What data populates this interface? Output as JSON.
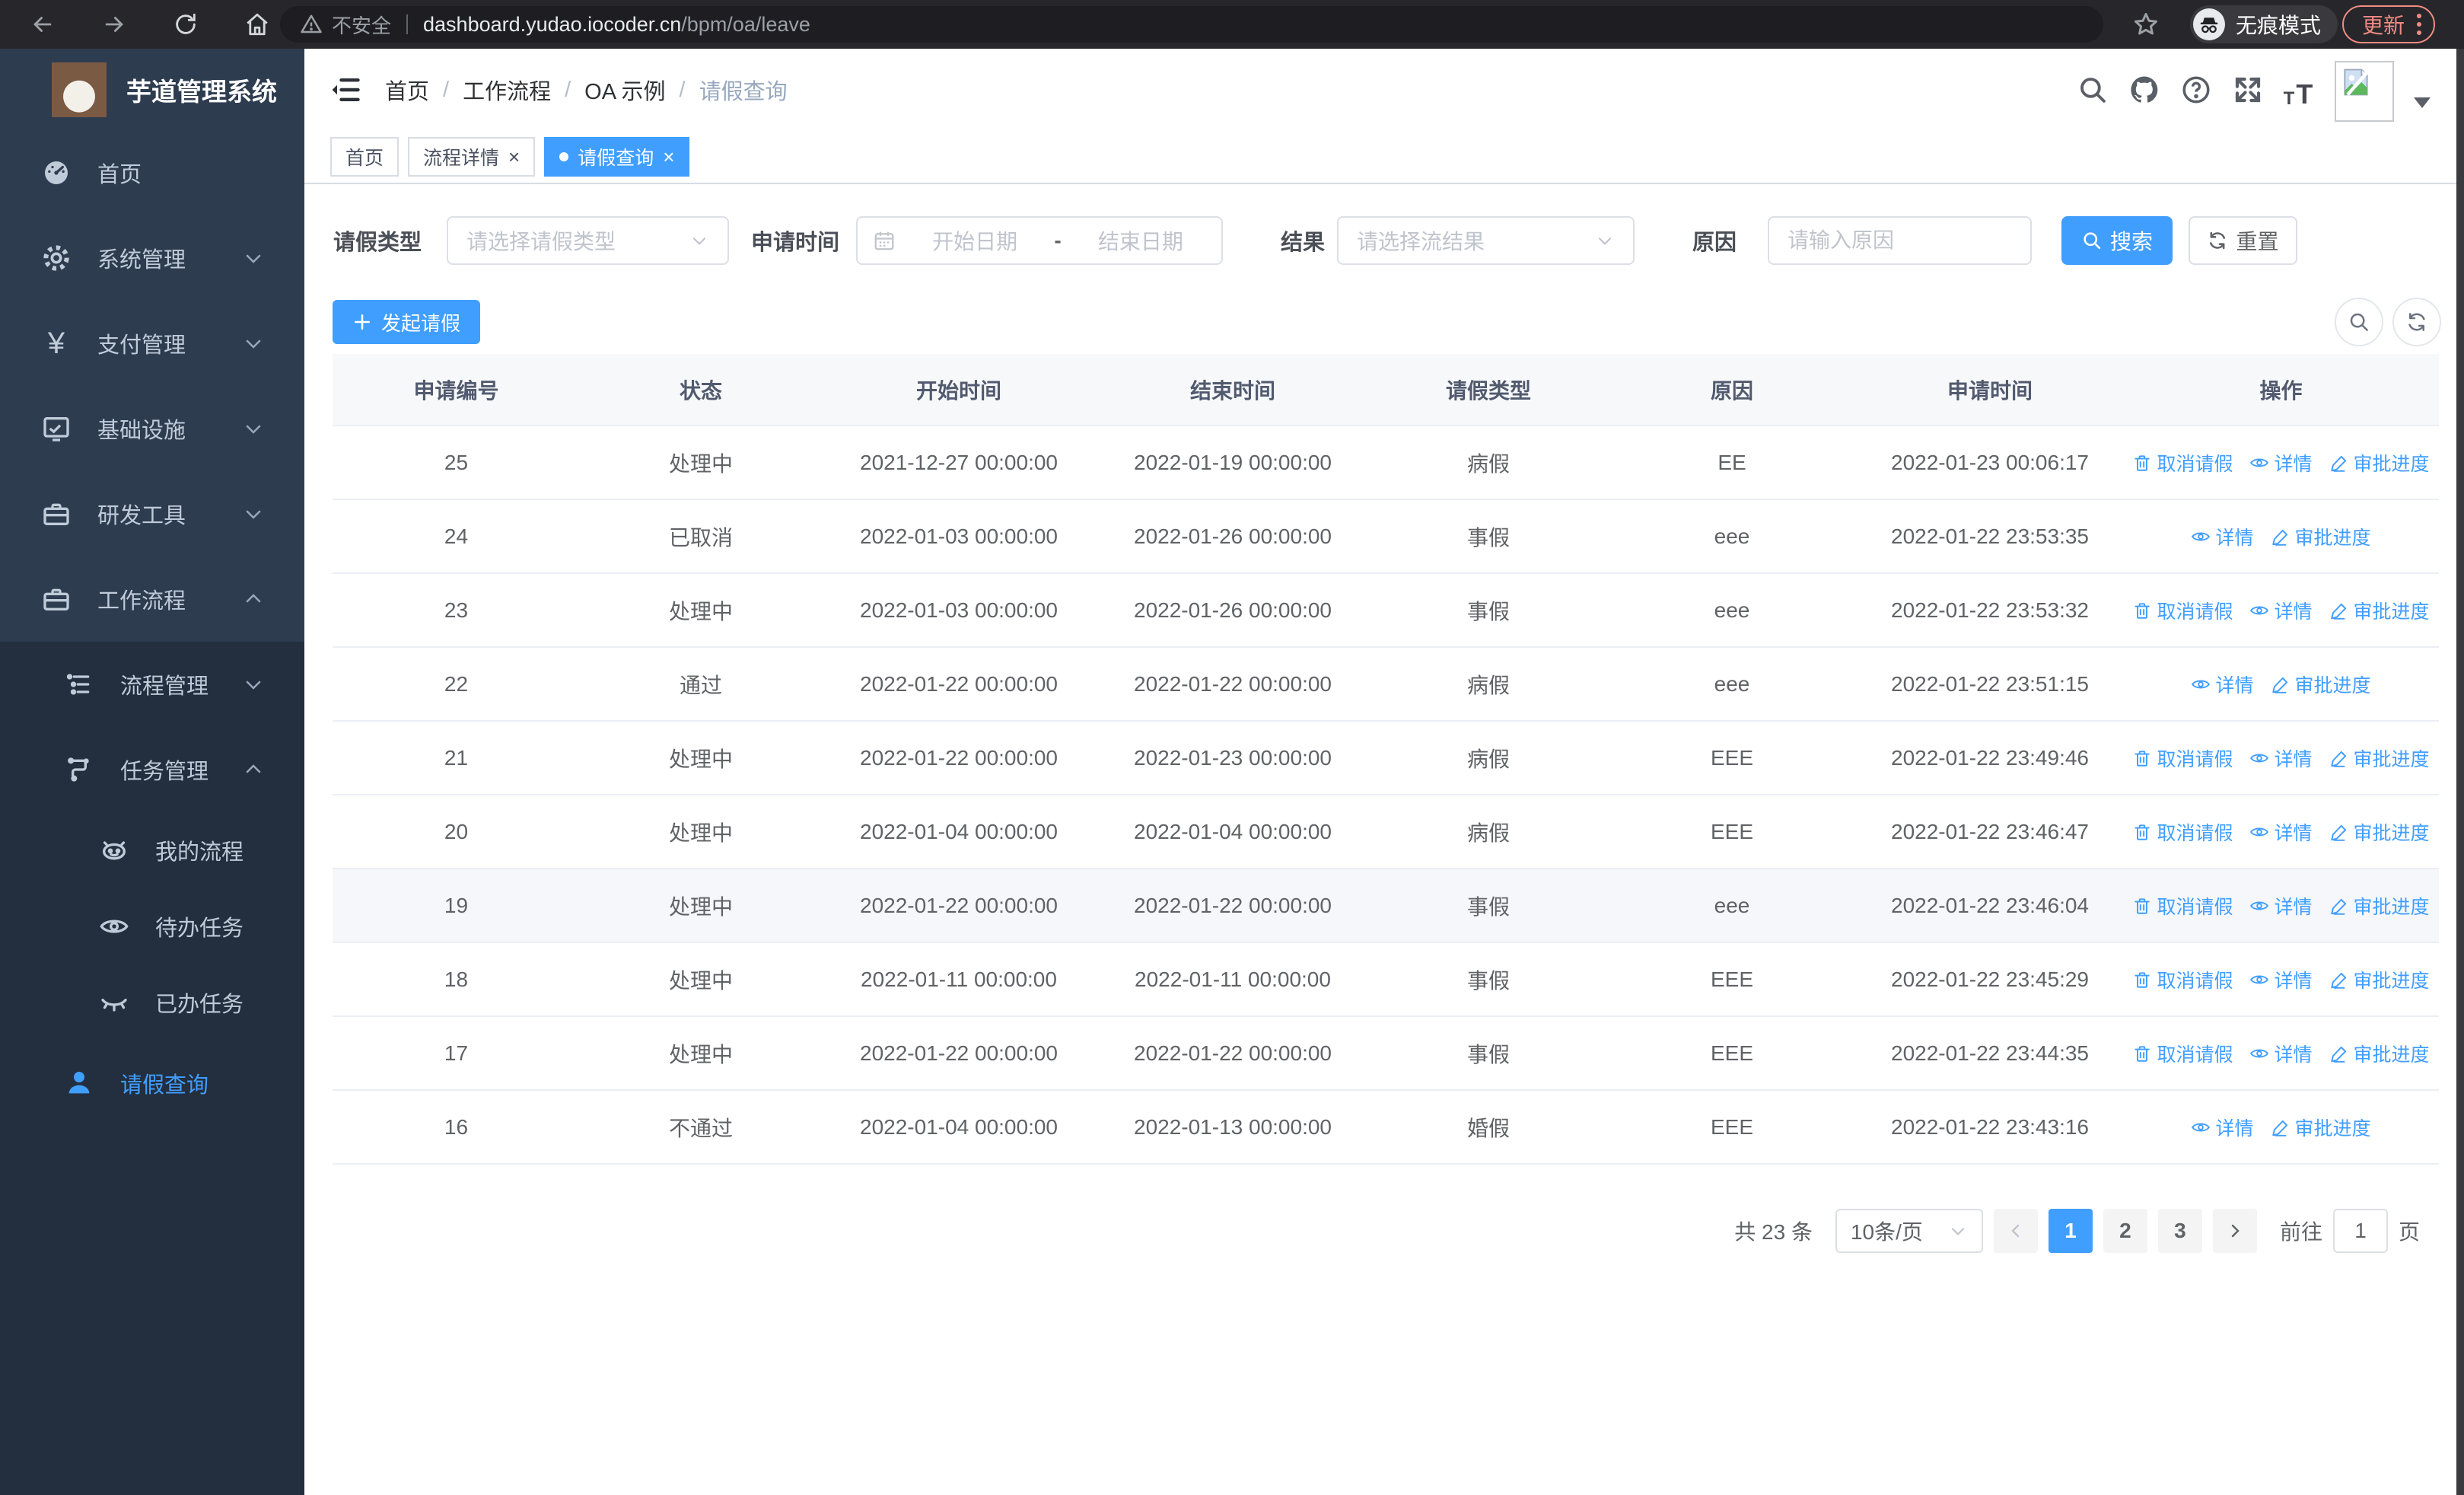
{
  "browser": {
    "security_label": "不安全",
    "url_host": "dashboard.yudao.iocoder.cn",
    "url_path": "/bpm/oa/leave",
    "incognito_label": "无痕模式",
    "update_label": "更新"
  },
  "glyphs": {
    "close": "×",
    "yen": "¥",
    "t_small": "T",
    "t_big": "T",
    "question": "?"
  },
  "colors": {
    "accent": "#409eff",
    "sidebar_bg": "#2e3c50",
    "sidebar_submenu_bg": "#232e3e"
  },
  "sidebar": {
    "app_title": "芋道管理系统",
    "items": [
      {
        "label": "首页"
      },
      {
        "label": "系统管理"
      },
      {
        "label": "支付管理"
      },
      {
        "label": "基础设施"
      },
      {
        "label": "研发工具"
      },
      {
        "label": "工作流程"
      },
      {
        "label": "流程管理"
      },
      {
        "label": "任务管理"
      },
      {
        "label": "我的流程"
      },
      {
        "label": "待办任务"
      },
      {
        "label": "已办任务"
      },
      {
        "label": "请假查询"
      }
    ]
  },
  "breadcrumb": {
    "separator": "/",
    "items": [
      "首页",
      "工作流程",
      "OA 示例",
      "请假查询"
    ]
  },
  "tabs": [
    {
      "label": "首页"
    },
    {
      "label": "流程详情"
    },
    {
      "label": "请假查询"
    }
  ],
  "filters": {
    "leave_type_label": "请假类型",
    "leave_type_placeholder": "请选择请假类型",
    "apply_time_label": "申请时间",
    "date_start_placeholder": "开始日期",
    "date_separator": "-",
    "date_end_placeholder": "结束日期",
    "result_label": "结果",
    "result_placeholder": "请选择流结果",
    "reason_label": "原因",
    "reason_placeholder": "请输入原因",
    "search_label": "搜索",
    "reset_label": "重置"
  },
  "toolbar": {
    "create_label": "发起请假"
  },
  "table": {
    "columns": [
      "申请编号",
      "状态",
      "开始时间",
      "结束时间",
      "请假类型",
      "原因",
      "申请时间",
      "操作"
    ],
    "actions": {
      "cancel": "取消请假",
      "detail": "详情",
      "progress": "审批进度"
    },
    "rows": [
      {
        "id": "25",
        "status": "处理中",
        "start": "2021-12-27 00:00:00",
        "end": "2022-01-19 00:00:00",
        "type": "病假",
        "reason": "EE",
        "apply_time": "2022-01-23 00:06:17",
        "cancel": true,
        "hover": false
      },
      {
        "id": "24",
        "status": "已取消",
        "start": "2022-01-03 00:00:00",
        "end": "2022-01-26 00:00:00",
        "type": "事假",
        "reason": "eee",
        "apply_time": "2022-01-22 23:53:35",
        "cancel": false,
        "hover": false
      },
      {
        "id": "23",
        "status": "处理中",
        "start": "2022-01-03 00:00:00",
        "end": "2022-01-26 00:00:00",
        "type": "事假",
        "reason": "eee",
        "apply_time": "2022-01-22 23:53:32",
        "cancel": true,
        "hover": false
      },
      {
        "id": "22",
        "status": "通过",
        "start": "2022-01-22 00:00:00",
        "end": "2022-01-22 00:00:00",
        "type": "病假",
        "reason": "eee",
        "apply_time": "2022-01-22 23:51:15",
        "cancel": false,
        "hover": false
      },
      {
        "id": "21",
        "status": "处理中",
        "start": "2022-01-22 00:00:00",
        "end": "2022-01-23 00:00:00",
        "type": "病假",
        "reason": "EEE",
        "apply_time": "2022-01-22 23:49:46",
        "cancel": true,
        "hover": false
      },
      {
        "id": "20",
        "status": "处理中",
        "start": "2022-01-04 00:00:00",
        "end": "2022-01-04 00:00:00",
        "type": "病假",
        "reason": "EEE",
        "apply_time": "2022-01-22 23:46:47",
        "cancel": true,
        "hover": false
      },
      {
        "id": "19",
        "status": "处理中",
        "start": "2022-01-22 00:00:00",
        "end": "2022-01-22 00:00:00",
        "type": "事假",
        "reason": "eee",
        "apply_time": "2022-01-22 23:46:04",
        "cancel": true,
        "hover": true
      },
      {
        "id": "18",
        "status": "处理中",
        "start": "2022-01-11 00:00:00",
        "end": "2022-01-11 00:00:00",
        "type": "事假",
        "reason": "EEE",
        "apply_time": "2022-01-22 23:45:29",
        "cancel": true,
        "hover": false
      },
      {
        "id": "17",
        "status": "处理中",
        "start": "2022-01-22 00:00:00",
        "end": "2022-01-22 00:00:00",
        "type": "事假",
        "reason": "EEE",
        "apply_time": "2022-01-22 23:44:35",
        "cancel": true,
        "hover": false
      },
      {
        "id": "16",
        "status": "不通过",
        "start": "2022-01-04 00:00:00",
        "end": "2022-01-13 00:00:00",
        "type": "婚假",
        "reason": "EEE",
        "apply_time": "2022-01-22 23:43:16",
        "cancel": false,
        "hover": false
      }
    ]
  },
  "pagination": {
    "total_label": "共 23 条",
    "page_size_label": "10条/页",
    "pages": [
      "1",
      "2",
      "3"
    ],
    "goto_label": "前往",
    "goto_value": "1",
    "goto_suffix": "页"
  }
}
